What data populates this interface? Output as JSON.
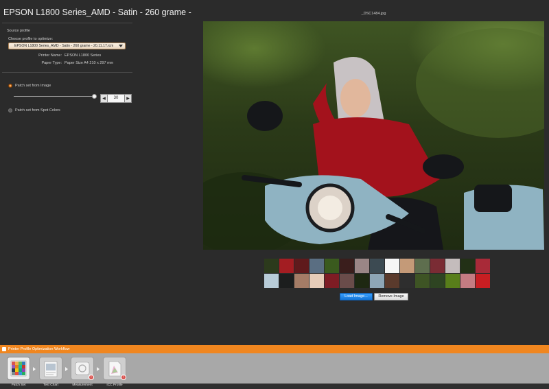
{
  "header": {
    "title": "EPSON L1800 Series_AMD - Satin - 260 grame -"
  },
  "left_panel": {
    "source_profile_heading": "Source profile",
    "choose_profile_label": "Choose profile to optimize:",
    "profile_select_value": "EPSON L1800 Series_AMD - Satin - 260 grame - 20.11.17.icm",
    "printer_name_label": "Printer Name:",
    "printer_name_value": "EPSON L1800 Series",
    "paper_type_label": "Paper Type:",
    "paper_type_value": "Paper Size A4  210 x 297 mm",
    "patch_from_image_label": "Patch set from Image",
    "patch_from_image_selected": true,
    "patch_count": "30",
    "patch_count_slider_fraction": 0.97,
    "patch_from_spot_label": "Patch set from Spot Colors",
    "patch_from_spot_selected": false
  },
  "image_area": {
    "filename": "_DSC1484.jpg",
    "load_button": "Load Image...",
    "remove_button": "Remove Image"
  },
  "patches": [
    "#2c3a1c",
    "#a31d22",
    "#5f1a1c",
    "#5a6e82",
    "#3a5a1e",
    "#3a1e1c",
    "#9a8686",
    "#3c4a52",
    "#f6f6f6",
    "#c49a78",
    "#5e6e4e",
    "#7a2c34",
    "#c4bcbc",
    "#223016",
    "#a82a38",
    "#b8ccd8",
    "#1c1e1e",
    "#a47c66",
    "#e6ccb8",
    "#7e1c24",
    "#6a4c4a",
    "#1e2812",
    "#8ea6b6",
    "#5a3a2c",
    "#2e2e2e",
    "#3e5424",
    "#2e4422",
    "#587e1a",
    "#c47c82",
    "#c81e22"
  ],
  "workflow": {
    "title": "Printer Profile Optimization Workflow",
    "steps": [
      {
        "label": "Patch Set"
      },
      {
        "label": "Test Chart"
      },
      {
        "label": "Measurement"
      },
      {
        "label": "ICC Profile"
      }
    ]
  }
}
